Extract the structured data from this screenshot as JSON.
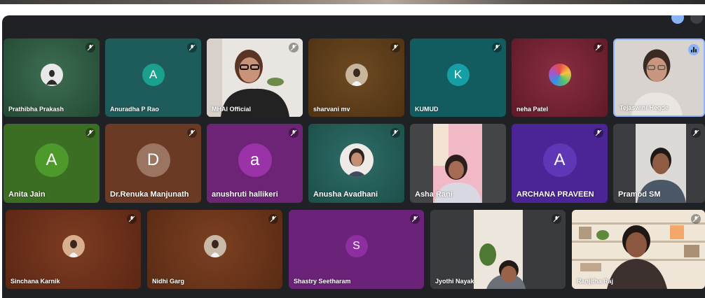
{
  "participants": {
    "p1": {
      "name": "Prathibha Prakash",
      "bg": "#2c5a3f"
    },
    "p2": {
      "name": "Anuradha P Rao",
      "initial": "A",
      "bg": "#1d5c5a",
      "avatar": "#1aa08d"
    },
    "p3": {
      "name": "MHAI Official",
      "bg": "#e6e1dc"
    },
    "p4": {
      "name": "sharvani mv",
      "bg": "#5a3a17"
    },
    "p5": {
      "name": "KUMUD",
      "initial": "K",
      "bg": "#125b5e",
      "avatar": "#16a0a6"
    },
    "p6": {
      "name": "neha Patel",
      "bg": "#6c1f2d"
    },
    "p7": {
      "name": "Tejaswini Hegde",
      "bg": "#cfcac5"
    },
    "p8": {
      "name": "Anita Jain",
      "initial": "A",
      "bg": "#3b6e23",
      "avatar": "#4d9a2b"
    },
    "p9": {
      "name": "Dr.Renuka Manjunath",
      "initial": "D",
      "bg": "#6b3a24",
      "avatar": "#9b7462"
    },
    "p10": {
      "name": "anushruti hallikeri",
      "initial": "a",
      "bg": "#6d2477",
      "avatar": "#9a33a7"
    },
    "p11": {
      "name": "Anusha Avadhani",
      "bg": "#1f5a55"
    },
    "p12": {
      "name": "Asha Rani",
      "bg": "#444547"
    },
    "p13": {
      "name": "ARCHANA PRAVEEN",
      "initial": "A",
      "bg": "#4b2596",
      "avatar": "#5f37b6"
    },
    "p14": {
      "name": "Pramod SM",
      "bg": "#3c3d40"
    },
    "p15": {
      "name": "Sinchana Karnik",
      "bg": "#6a2d18"
    },
    "p16": {
      "name": "Nidhi Garg",
      "bg": "#6a3319"
    },
    "p17": {
      "name": "Shastry Seetharam",
      "initial": "S",
      "bg": "#6a2379",
      "avatar": "#8e2ea0"
    },
    "p18": {
      "name": "Jyothi Nayak",
      "bg": "#3a3b3d"
    },
    "p19": {
      "name": "Ranjitha Raj",
      "bg": "#d9c9b4"
    }
  },
  "icons": {
    "mic_off": "mic-off-icon",
    "speaking": "audio-level-icon"
  },
  "colors": {
    "meet_background": "#202124",
    "speaking_border": "#8ab4f8"
  }
}
